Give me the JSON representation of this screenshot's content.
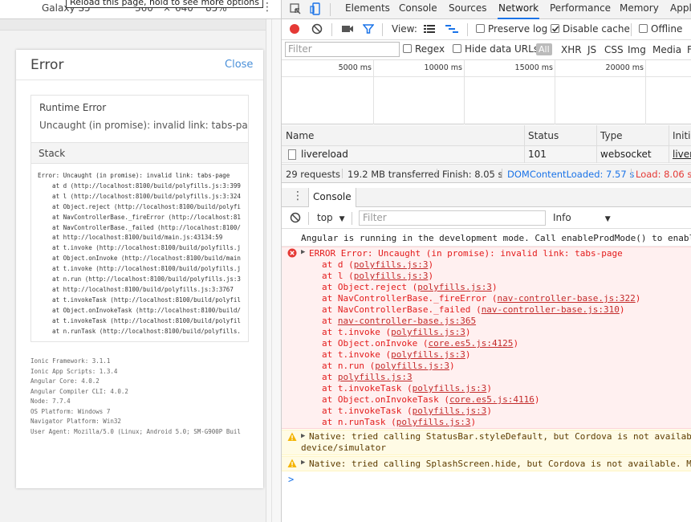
{
  "device_toolbar": {
    "device": "Galaxy S5",
    "width": "360",
    "times": "×",
    "height": "640",
    "zoom": "85%",
    "tooltip": "Reload this page, hold to see more options"
  },
  "error_modal": {
    "title": "Error",
    "close": "Close",
    "runtime_title": "Runtime Error",
    "runtime_message": "Uncaught (in promise): invalid link: tabs-page",
    "stack_title": "Stack",
    "stack": [
      "Error: Uncaught (in promise): invalid link: tabs-page",
      "    at d (http://localhost:8100/build/polyfills.js:3:399",
      "    at l (http://localhost:8100/build/polyfills.js:3:324",
      "    at Object.reject (http://localhost:8100/build/polyfi",
      "    at NavControllerBase._fireError (http://localhost:81",
      "    at NavControllerBase._failed (http://localhost:8100/",
      "    at http://localhost:8100/build/main.js:43134:59",
      "    at t.invoke (http://localhost:8100/build/polyfills.j",
      "    at Object.onInvoke (http://localhost:8100/build/main",
      "    at t.invoke (http://localhost:8100/build/polyfills.j",
      "    at n.run (http://localhost:8100/build/polyfills.js:3",
      "    at http://localhost:8100/build/polyfills.js:3:3767",
      "    at t.invokeTask (http://localhost:8100/build/polyfil",
      "    at Object.onInvokeTask (http://localhost:8100/build/",
      "    at t.invokeTask (http://localhost:8100/build/polyfil",
      "    at n.runTask (http://localhost:8100/build/polyfills."
    ],
    "env": [
      "Ionic Framework: 3.1.1",
      "Ionic App Scripts: 1.3.4",
      "Angular Core: 4.0.2",
      "Angular Compiler CLI: 4.0.2",
      "Node: 7.7.4",
      "OS Platform: Windows 7",
      "Navigator Platform: Win32",
      "User Agent: Mozilla/5.0 (Linux; Android 5.0; SM-G900P Buil"
    ]
  },
  "devtools": {
    "tabs": [
      "Elements",
      "Console",
      "Sources",
      "Network",
      "Performance",
      "Memory",
      "Appl"
    ],
    "active_tab": "Network",
    "network_toolbar": {
      "view_label": "View:",
      "preserve_log": "Preserve log",
      "preserve_log_checked": false,
      "disable_cache": "Disable cache",
      "disable_cache_checked": true,
      "offline": "Offline"
    },
    "filter": {
      "placeholder": "Filter",
      "regex": "Regex",
      "hide_data_urls": "Hide data URLs",
      "types": [
        "All",
        "XHR",
        "JS",
        "CSS",
        "Img",
        "Media",
        "F"
      ]
    },
    "timeline_ticks": [
      "5000 ms",
      "10000 ms",
      "15000 ms",
      "20000 ms"
    ],
    "columns": [
      "Name",
      "Status",
      "Type",
      "Initia"
    ],
    "rows": [
      {
        "name": "livereload",
        "status": "101",
        "type": "websocket",
        "initiator": "liver"
      }
    ],
    "summary": {
      "requests": "29 requests",
      "transferred": "19.2 MB transferred",
      "finish": "Finish: 8.05 s",
      "dcl": "DOMContentLoaded: 7.57 s",
      "load": "Load: 8.06 s"
    },
    "drawer_tab": "Console",
    "console_toolbar": {
      "context": "top",
      "filter_placeholder": "Filter",
      "level": "Info"
    },
    "console": {
      "info_message": "Angular is running in the development mode. Call enableProdMode() to enabl",
      "error_text": "ERROR Error: Uncaught (in promise): invalid link: tabs-page",
      "error_stack": [
        {
          "pre": "at d ",
          "link": "polyfills.js:3"
        },
        {
          "pre": "at l ",
          "link": "polyfills.js:3"
        },
        {
          "pre": "at Object.reject ",
          "link": "polyfills.js:3"
        },
        {
          "pre": "at NavControllerBase._fireError ",
          "link": "nav-controller-base.js:322"
        },
        {
          "pre": "at NavControllerBase._failed ",
          "link": "nav-controller-base.js:310"
        },
        {
          "pre": "at ",
          "link": "nav-controller-base.js:365",
          "nowrap": true
        },
        {
          "pre": "at t.invoke ",
          "link": "polyfills.js:3"
        },
        {
          "pre": "at Object.onInvoke ",
          "link": "core.es5.js:4125"
        },
        {
          "pre": "at t.invoke ",
          "link": "polyfills.js:3"
        },
        {
          "pre": "at n.run ",
          "link": "polyfills.js:3"
        },
        {
          "pre": "at ",
          "link": "polyfills.js:3",
          "nowrap": true
        },
        {
          "pre": "at t.invokeTask ",
          "link": "polyfills.js:3"
        },
        {
          "pre": "at Object.onInvokeTask ",
          "link": "core.es5.js:4116"
        },
        {
          "pre": "at t.invokeTask ",
          "link": "polyfills.js:3"
        },
        {
          "pre": "at n.runTask ",
          "link": "polyfills.js:3"
        }
      ],
      "warning1_line1": "Native: tried calling StatusBar.styleDefault, but Cordova is not availab",
      "warning1_line2": "device/simulator",
      "warning2": "Native: tried calling SplashScreen.hide, but Cordova is not available. M",
      "prompt": ">"
    }
  },
  "colors": {
    "error_red": "#e31b1b",
    "link_blue": "#1a73e8",
    "warn_bg": "#fffbe5",
    "error_bg": "#fff0f0"
  }
}
